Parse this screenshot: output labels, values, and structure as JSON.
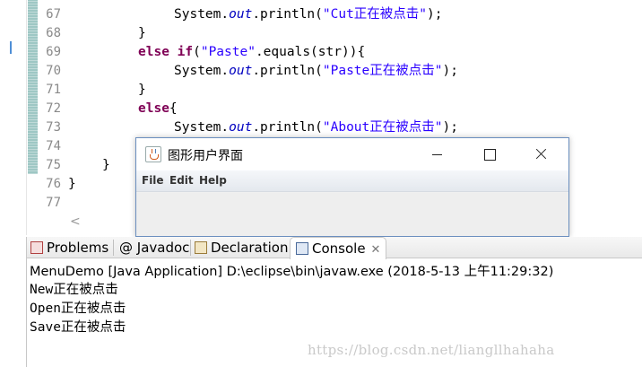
{
  "editor": {
    "lines": [
      {
        "num": "67",
        "parts": [
          {
            "t": "System.",
            "c": ""
          },
          {
            "t": "out",
            "c": "fld"
          },
          {
            "t": ".println(",
            "c": ""
          },
          {
            "t": "\"Cut正在被点击\"",
            "c": "str"
          },
          {
            "t": ");",
            "c": ""
          }
        ]
      },
      {
        "num": "68",
        "parts": [
          {
            "t": "}",
            "c": ""
          }
        ]
      },
      {
        "num": "69",
        "parts": [
          {
            "t": "else if",
            "c": "kw"
          },
          {
            "t": "(",
            "c": ""
          },
          {
            "t": "\"Paste\"",
            "c": "str"
          },
          {
            "t": ".equals(str)){",
            "c": ""
          }
        ]
      },
      {
        "num": "70",
        "parts": [
          {
            "t": "System.",
            "c": ""
          },
          {
            "t": "out",
            "c": "fld"
          },
          {
            "t": ".println(",
            "c": ""
          },
          {
            "t": "\"Paste正在被点击\"",
            "c": "str"
          },
          {
            "t": ");",
            "c": ""
          }
        ]
      },
      {
        "num": "71",
        "parts": [
          {
            "t": "}",
            "c": ""
          }
        ]
      },
      {
        "num": "72",
        "parts": [
          {
            "t": "else",
            "c": "kw"
          },
          {
            "t": "{",
            "c": ""
          }
        ]
      },
      {
        "num": "73",
        "parts": [
          {
            "t": "System.",
            "c": ""
          },
          {
            "t": "out",
            "c": "fld"
          },
          {
            "t": ".println(",
            "c": ""
          },
          {
            "t": "\"About正在被点击\"",
            "c": "str"
          },
          {
            "t": ");",
            "c": ""
          }
        ]
      },
      {
        "num": "74",
        "parts": []
      },
      {
        "num": "75",
        "parts": [
          {
            "t": "}",
            "c": ""
          }
        ]
      },
      {
        "num": "76",
        "parts": [
          {
            "t": "}",
            "c": ""
          }
        ]
      },
      {
        "num": "77",
        "parts": []
      }
    ],
    "scroll_left_glyph": "<"
  },
  "window": {
    "title": "图形用户界面",
    "menus": [
      "File",
      "Edit",
      "Help"
    ]
  },
  "panel": {
    "tabs": [
      {
        "label": "Problems",
        "icon": "problems-icon"
      },
      {
        "label": "@ Javadoc",
        "icon": "javadoc-icon"
      },
      {
        "label": "Declaration",
        "icon": "declaration-icon"
      },
      {
        "label": "Console",
        "icon": "console-icon",
        "close": "✕"
      }
    ],
    "process": "MenuDemo [Java Application] D:\\eclipse\\bin\\javaw.exe (2018-5-13 上午11:29:32)",
    "output": [
      "New正在被点击",
      "Open正在被点击",
      "Save正在被点击"
    ]
  },
  "watermark": "https://blog.csdn.net/liangllhahaha"
}
